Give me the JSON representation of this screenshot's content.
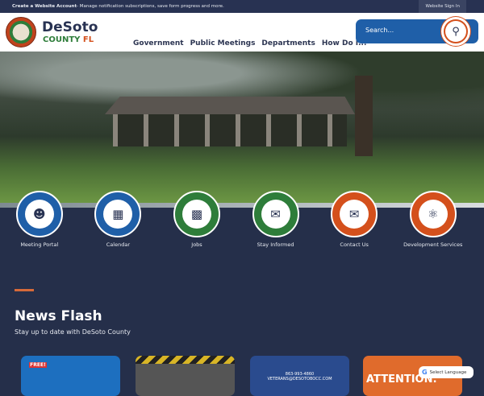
{
  "topbar": {
    "account_bold": "Create a Website Account",
    "account_text": " - Manage notification subscriptions, save form progress and more.",
    "sign_in": "Website Sign In"
  },
  "brand": {
    "name": "DeSoto",
    "county": "COUNTY ",
    "state": "FL"
  },
  "nav": [
    "Government",
    "Public Meetings",
    "Departments",
    "How Do I..."
  ],
  "search": {
    "placeholder": "Search..."
  },
  "quick_links": [
    {
      "label": "Meeting Portal",
      "icon": "people-icon",
      "color": "#1f5fa8"
    },
    {
      "label": "Calendar",
      "icon": "calendar-icon",
      "color": "#1f5fa8"
    },
    {
      "label": "Jobs",
      "icon": "briefcase-icon",
      "color": "#2e7d3a"
    },
    {
      "label": "Stay Informed",
      "icon": "mail-icon",
      "color": "#2e7d3a"
    },
    {
      "label": "Contact Us",
      "icon": "chat-icon",
      "color": "#d4501c"
    },
    {
      "label": "Development Services",
      "icon": "idea-icon",
      "color": "#d4501c"
    }
  ],
  "news": {
    "title": "News Flash",
    "subtitle": "Stay up to date with DeSoto County",
    "cards": [
      {
        "text": "FREE!"
      },
      {
        "text": ""
      },
      {
        "phone": "863-993-4860",
        "email": "VETERANS@DESOTOBOCC.COM"
      },
      {
        "text": "ATTENTION:"
      }
    ]
  },
  "translate": {
    "label": "Select Language"
  }
}
